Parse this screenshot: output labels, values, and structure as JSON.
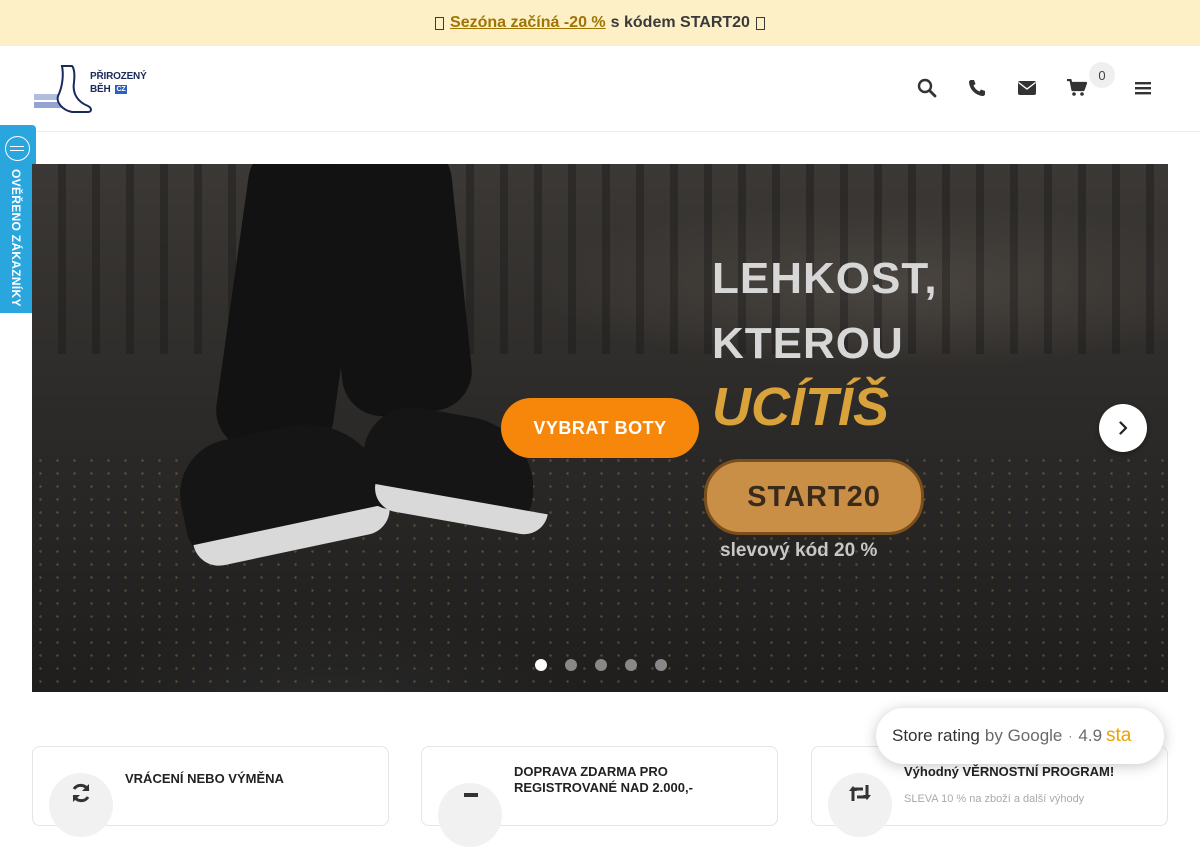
{
  "promo": {
    "icon_left": "star-icon",
    "link_text": "Sezóna začíná -20 %",
    "rest_text": "s kódem START20",
    "icon_right": "star-icon"
  },
  "header": {
    "logo_line1": "PŘIROZENÝ",
    "logo_line2": "BĚH",
    "logo_badge": "CZ",
    "icons": [
      "search-icon",
      "phone-icon",
      "envelope-icon",
      "cart-icon",
      "menu-icon"
    ],
    "cart_count": "0"
  },
  "side_badge": {
    "label": "OVĚŘENO ZÁKAZNÍKY"
  },
  "hero": {
    "headline_line1": "LEHKOST,",
    "headline_line2": "KTEROU",
    "headline_line3": "UCÍTÍŠ",
    "code": "START20",
    "code_subtitle": "slevový kód 20 %",
    "cta_label": "VYBRAT BOTY",
    "slide_count": 5,
    "active_slide": 1
  },
  "benefits": [
    {
      "icon": "refresh-icon",
      "title": "VRÁCENÍ NEBO VÝMĚNA",
      "subtitle": ""
    },
    {
      "icon": "truck-icon",
      "title": "DOPRAVA ZDARMA PRO REGISTROVANÉ NAD 2.000,-",
      "subtitle": ""
    },
    {
      "icon": "retweet-icon",
      "title": "Výhodný VĚRNOSTNÍ PROGRAM!",
      "subtitle": "SLEVA 10 % na zboží a další výhody"
    }
  ],
  "rating": {
    "label": "Store rating",
    "by": "by Google",
    "separator": "·",
    "score": "4.9",
    "stars_text": "sta"
  },
  "colors": {
    "promo_bg": "#fdf0c7",
    "promo_link": "#a07400",
    "cta_orange": "#f7870a",
    "badge_blue": "#2aa6df",
    "star_yellow": "#e8a400"
  }
}
